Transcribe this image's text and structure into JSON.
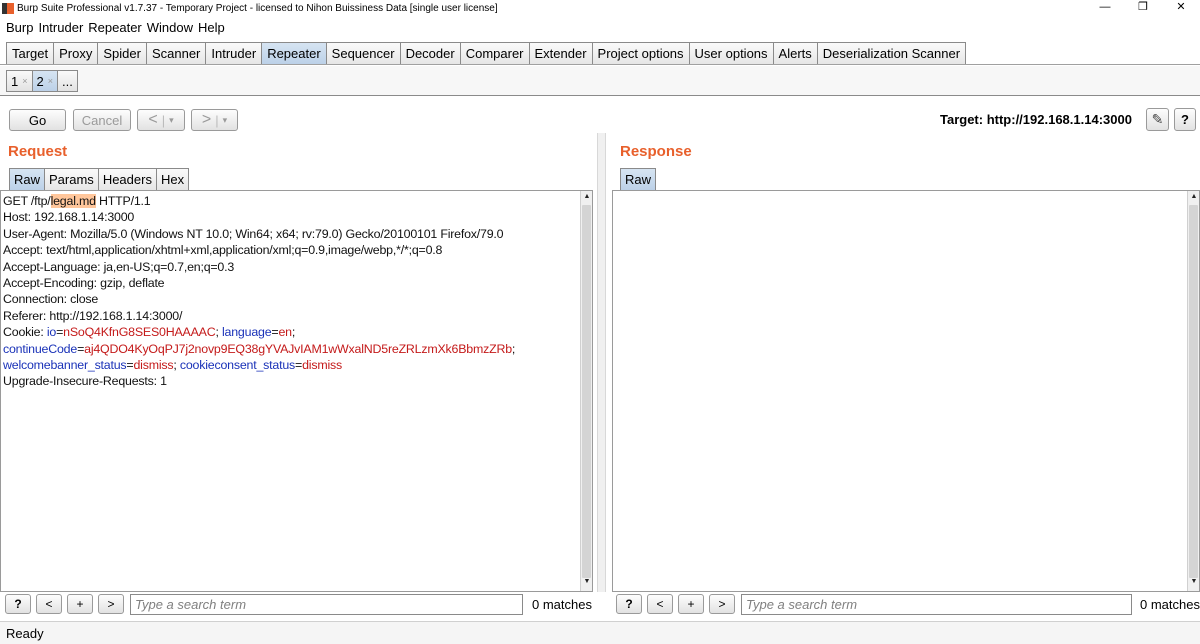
{
  "window": {
    "title": "Burp Suite Professional v1.7.37 - Temporary Project - licensed to Nihon Buissiness Data [single user license]",
    "controls": [
      "—",
      "❐",
      "✕"
    ]
  },
  "menu": [
    "Burp",
    "Intruder",
    "Repeater",
    "Window",
    "Help"
  ],
  "main_tabs": [
    "Target",
    "Proxy",
    "Spider",
    "Scanner",
    "Intruder",
    "Repeater",
    "Sequencer",
    "Decoder",
    "Comparer",
    "Extender",
    "Project options",
    "User options",
    "Alerts",
    "Deserialization Scanner"
  ],
  "active_main_tab": "Repeater",
  "sub_tabs": [
    {
      "label": "1",
      "close": "×"
    },
    {
      "label": "2",
      "close": "×"
    },
    {
      "label": "..."
    }
  ],
  "toolbar": {
    "go": "Go",
    "cancel": "Cancel",
    "back": "<",
    "forward": ">",
    "dropdown": "▾",
    "target": "Target: http://192.168.1.14:3000",
    "edit_icon": "✎",
    "help": "?"
  },
  "request": {
    "title": "Request",
    "tabs": [
      "Raw",
      "Params",
      "Headers",
      "Hex"
    ],
    "lines": {
      "l1_a": "GET /ftp/",
      "l1_hl": "legal.md",
      "l1_b": " HTTP/1.1",
      "l2": "Host: 192.168.1.14:3000",
      "l3": "User-Agent: Mozilla/5.0 (Windows NT 10.0; Win64; x64; rv:79.0) Gecko/20100101 Firefox/79.0",
      "l4": "Accept: text/html,application/xhtml+xml,application/xml;q=0.9,image/webp,*/*;q=0.8",
      "l5": "Accept-Language: ja,en-US;q=0.7,en;q=0.3",
      "l6": "Accept-Encoding: gzip, deflate",
      "l7": "Connection: close",
      "l8": "Referer: http://192.168.1.14:3000/",
      "cookie_label": "Cookie: ",
      "c_io_k": "io",
      "c_io_v": "nSoQ4KfnG8SES0HAAAAC",
      "c_lang_k": "language",
      "c_lang_v": "en",
      "c_cont_k": "continueCode",
      "c_cont_v": "aj4QDO4KyOqPJ7j2novp9EQ38gYVAJvIAM1wWxalND5reZRLzmXk6BbmzZRb",
      "c_wb_k": "welcomebanner_status",
      "c_wb_v": "dismiss",
      "c_cc_k": "cookieconsent_status",
      "c_cc_v": "dismiss",
      "eq": "=",
      "semi": "; ",
      "semi_end": ";",
      "l_last": "Upgrade-Insecure-Requests: 1"
    }
  },
  "response": {
    "title": "Response",
    "tabs": [
      "Raw"
    ]
  },
  "search_bar": {
    "help": "?",
    "prev": "<",
    "add": "+",
    "next": ">",
    "placeholder": "Type a search term",
    "req_matches": "0 matches",
    "resp_matches": "0 matches"
  },
  "scroll": {
    "up": "▲",
    "down": "▼"
  },
  "status": "Ready"
}
